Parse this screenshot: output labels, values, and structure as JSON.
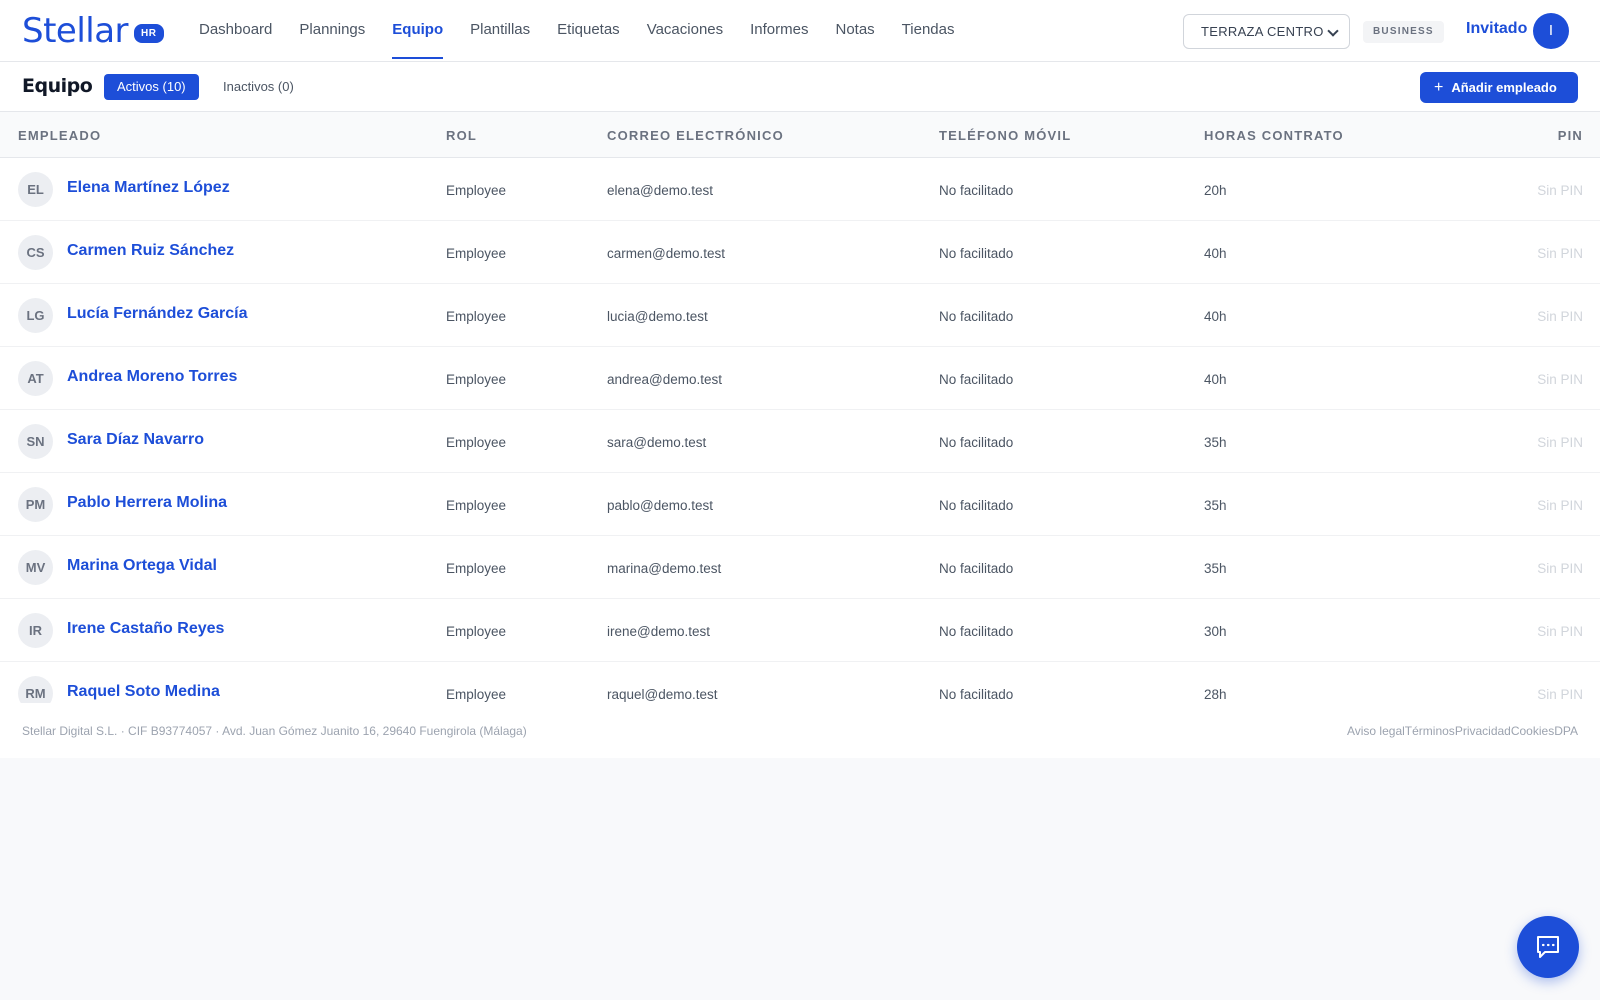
{
  "brand": {
    "name": "Stellar",
    "badge": "HR",
    "color": "#1d4ed8"
  },
  "nav": {
    "items": [
      "Dashboard",
      "Plannings",
      "Equipo",
      "Plantillas",
      "Etiquetas",
      "Vacaciones",
      "Informes",
      "Notas",
      "Tiendas"
    ],
    "active": "Equipo"
  },
  "header": {
    "store": "TERRAZA CENTRO",
    "plan": "BUSINESS",
    "user_name": "Invitado",
    "user_initial": "I"
  },
  "page": {
    "title": "Equipo",
    "tab_active": "Activos (10)",
    "tab_inactive": "Inactivos (0)",
    "add_button": "Añadir empleado"
  },
  "table": {
    "columns": {
      "employee": "EMPLEADO",
      "role": "ROL",
      "email": "CORREO ELECTRÓNICO",
      "phone": "TELÉFONO MÓVIL",
      "hours": "HORAS CONTRATO",
      "pin": "PIN"
    },
    "rows": [
      {
        "initials": "EL",
        "name": "Elena Martínez López",
        "role": "Employee",
        "email": "elena@demo.test",
        "phone": "No facilitado",
        "hours": "20h",
        "pin": "Sin PIN"
      },
      {
        "initials": "CS",
        "name": "Carmen Ruiz Sánchez",
        "role": "Employee",
        "email": "carmen@demo.test",
        "phone": "No facilitado",
        "hours": "40h",
        "pin": "Sin PIN"
      },
      {
        "initials": "LG",
        "name": "Lucía Fernández García",
        "role": "Employee",
        "email": "lucia@demo.test",
        "phone": "No facilitado",
        "hours": "40h",
        "pin": "Sin PIN"
      },
      {
        "initials": "AT",
        "name": "Andrea Moreno Torres",
        "role": "Employee",
        "email": "andrea@demo.test",
        "phone": "No facilitado",
        "hours": "40h",
        "pin": "Sin PIN"
      },
      {
        "initials": "SN",
        "name": "Sara Díaz Navarro",
        "role": "Employee",
        "email": "sara@demo.test",
        "phone": "No facilitado",
        "hours": "35h",
        "pin": "Sin PIN"
      },
      {
        "initials": "PM",
        "name": "Pablo Herrera Molina",
        "role": "Employee",
        "email": "pablo@demo.test",
        "phone": "No facilitado",
        "hours": "35h",
        "pin": "Sin PIN"
      },
      {
        "initials": "MV",
        "name": "Marina Ortega Vidal",
        "role": "Employee",
        "email": "marina@demo.test",
        "phone": "No facilitado",
        "hours": "35h",
        "pin": "Sin PIN"
      },
      {
        "initials": "IR",
        "name": "Irene Castaño Reyes",
        "role": "Employee",
        "email": "irene@demo.test",
        "phone": "No facilitado",
        "hours": "30h",
        "pin": "Sin PIN"
      },
      {
        "initials": "RM",
        "name": "Raquel Soto Medina",
        "role": "Employee",
        "email": "raquel@demo.test",
        "phone": "No facilitado",
        "hours": "28h",
        "pin": "Sin PIN"
      }
    ]
  },
  "footer": {
    "company": "Stellar Digital S.L. · CIF B93774057 · Avd. Juan Gómez Juanito 16, 29640 Fuengirola (Málaga)",
    "links": [
      "Aviso legal",
      "Términos",
      "Privacidad",
      "Cookies",
      "DPA"
    ]
  },
  "chat": {
    "icon": "chat-icon"
  }
}
